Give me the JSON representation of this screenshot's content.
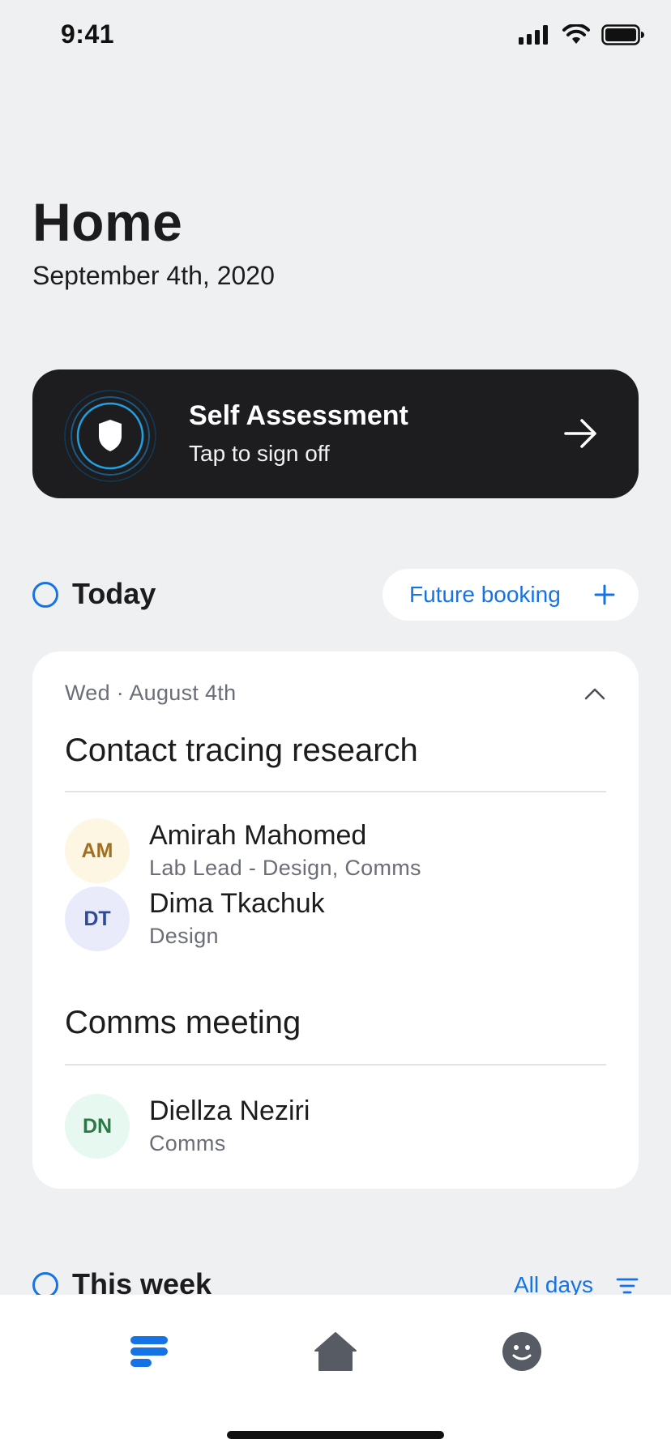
{
  "status_bar": {
    "time": "9:41"
  },
  "header": {
    "title": "Home",
    "date": "September 4th, 2020"
  },
  "self_assessment": {
    "title": "Self Assessment",
    "subtitle": "Tap to sign off"
  },
  "today": {
    "label": "Today",
    "future_booking_label": "Future booking"
  },
  "card": {
    "date": "Wed · August 4th",
    "meetings": [
      {
        "title": "Contact tracing research",
        "people": [
          {
            "initials": "AM",
            "name": "Amirah Mahomed",
            "role": "Lab Lead - Design, Comms"
          },
          {
            "initials": "DT",
            "name": "Dima Tkachuk",
            "role": "Design"
          }
        ]
      },
      {
        "title": "Comms meeting",
        "people": [
          {
            "initials": "DN",
            "name": "Diellza Neziri",
            "role": "Comms"
          }
        ]
      }
    ]
  },
  "this_week": {
    "label": "This week",
    "filter_label": "All days"
  },
  "colors": {
    "accent": "#1673e6",
    "card_dark": "#1d1d1f",
    "background": "#eff0f2",
    "avatar_am_bg": "#fdf6e3",
    "avatar_am_fg": "#a0701f",
    "avatar_dt_bg": "#e9ebfb",
    "avatar_dt_fg": "#2e4b9a",
    "avatar_dn_bg": "#e6f8ef",
    "avatar_dn_fg": "#2a7a47"
  },
  "tabbar": {
    "tabs": [
      {
        "icon": "list-icon",
        "active": true
      },
      {
        "icon": "home-icon",
        "active": false
      },
      {
        "icon": "smiley-icon",
        "active": false
      }
    ]
  }
}
